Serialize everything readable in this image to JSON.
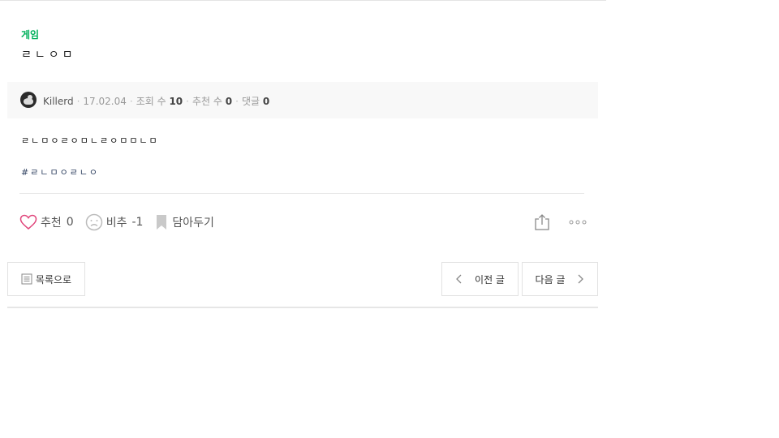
{
  "post": {
    "category": "게임",
    "title": "ㄹㄴㅇㅁ",
    "body": "ㄹㄴㅁㅇㄹㅇㅁㄴㄹㅇㅁㅁㄴㅁ",
    "tags": "#ㄹㄴㅁㅇㄹㄴㅇ"
  },
  "meta": {
    "author": "Killerd",
    "date": "17.02.04",
    "views_label": "조회 수",
    "views": "10",
    "votes_label": "추천 수",
    "votes": "0",
    "comments_label": "댓글",
    "comments": "0",
    "separator": "·"
  },
  "actions": {
    "like_label": "추천",
    "like_count": "0",
    "dislike_label": "비추",
    "dislike_count": "-1",
    "bookmark_label": "담아두기"
  },
  "nav": {
    "list_label": "목록으로",
    "prev_label": "이전 글",
    "next_label": "다음 글"
  },
  "colors": {
    "category": "#00b05b",
    "like_heart": "#e0447a",
    "meta_bg": "#f8f8f8"
  },
  "icons": [
    "avatar-duck",
    "heart-icon",
    "sad-face-icon",
    "bookmark-icon",
    "share-icon",
    "more-dots-icon",
    "list-icon",
    "chevron-left-icon",
    "chevron-right-icon"
  ]
}
